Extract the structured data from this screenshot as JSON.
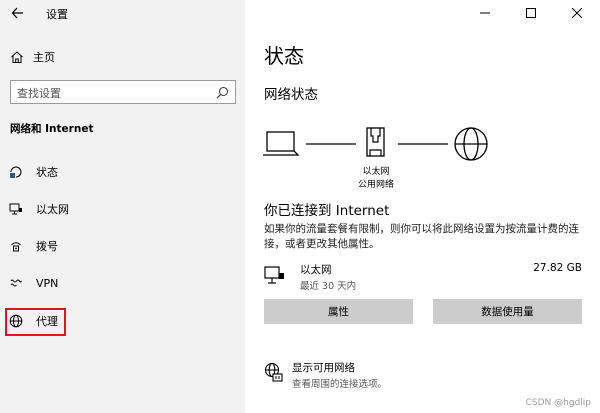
{
  "window": {
    "title": "设置",
    "minimize": "—",
    "maximize": "☐",
    "close": "✕"
  },
  "sidebar": {
    "home_label": "主页",
    "search_placeholder": "查找设置",
    "section_title": "网络和 Internet",
    "items": [
      {
        "label": "状态",
        "icon": "status-globe-icon"
      },
      {
        "label": "以太网",
        "icon": "ethernet-monitor-icon"
      },
      {
        "label": "拨号",
        "icon": "dialup-icon"
      },
      {
        "label": "VPN",
        "icon": "vpn-icon"
      },
      {
        "label": "代理",
        "icon": "globe-icon"
      }
    ]
  },
  "main": {
    "title": "状态",
    "network_status_heading": "网络状态",
    "diagram": {
      "node_label_1": "以太网",
      "node_label_2": "公用网络"
    },
    "connected_heading": "你已连接到 Internet",
    "description": "如果你的流量套餐有限制，则你可以将此网络设置为按流量计费的连接，或者更改其他属性。",
    "connection": {
      "name": "以太网",
      "time": "最近 30 天内",
      "size": "27.82 GB"
    },
    "buttons": {
      "properties": "属性",
      "data_usage": "数据使用量"
    },
    "available": {
      "title": "显示可用网络",
      "subtitle": "查看周围的连接选项。"
    }
  },
  "watermark": "CSDN @hgdlip",
  "colors": {
    "sidebar_bg": "#f2f2f2",
    "accent": "#0078d7",
    "highlight": "#e0141e",
    "button_bg": "#cccccc"
  }
}
